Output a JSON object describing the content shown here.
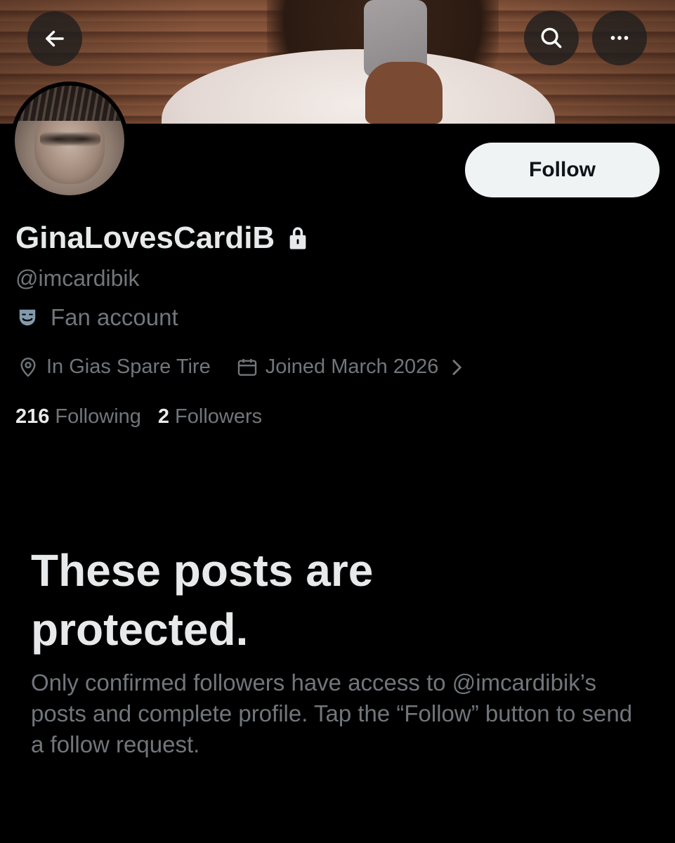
{
  "header": {
    "back_icon": "arrow-left-icon",
    "search_icon": "search-icon",
    "more_icon": "more-horizontal-icon"
  },
  "profile": {
    "display_name": "GinaLovesCardiB",
    "handle": "@imcardibik",
    "protected_icon": "lock-icon",
    "category_icon": "theater-mask-icon",
    "category": "Fan account",
    "location_icon": "location-pin-icon",
    "location": "In Gias Spare Tire",
    "joined_icon": "calendar-icon",
    "joined": "Joined March 2026",
    "following_count": "216",
    "following_label": "Following",
    "followers_count": "2",
    "followers_label": "Followers"
  },
  "actions": {
    "follow_label": "Follow"
  },
  "protected_notice": {
    "title": "These posts are protected.",
    "body": "Only confirmed followers have access to @imcardibik’s posts and complete profile. Tap the “Follow” button to send a follow request."
  },
  "colors": {
    "background": "#000000",
    "primary_text": "#e7e9ea",
    "secondary_text": "#71767b",
    "follow_button_bg": "#eff3f4",
    "follow_button_text": "#0f1419",
    "category_icon_color": "#829aab"
  }
}
